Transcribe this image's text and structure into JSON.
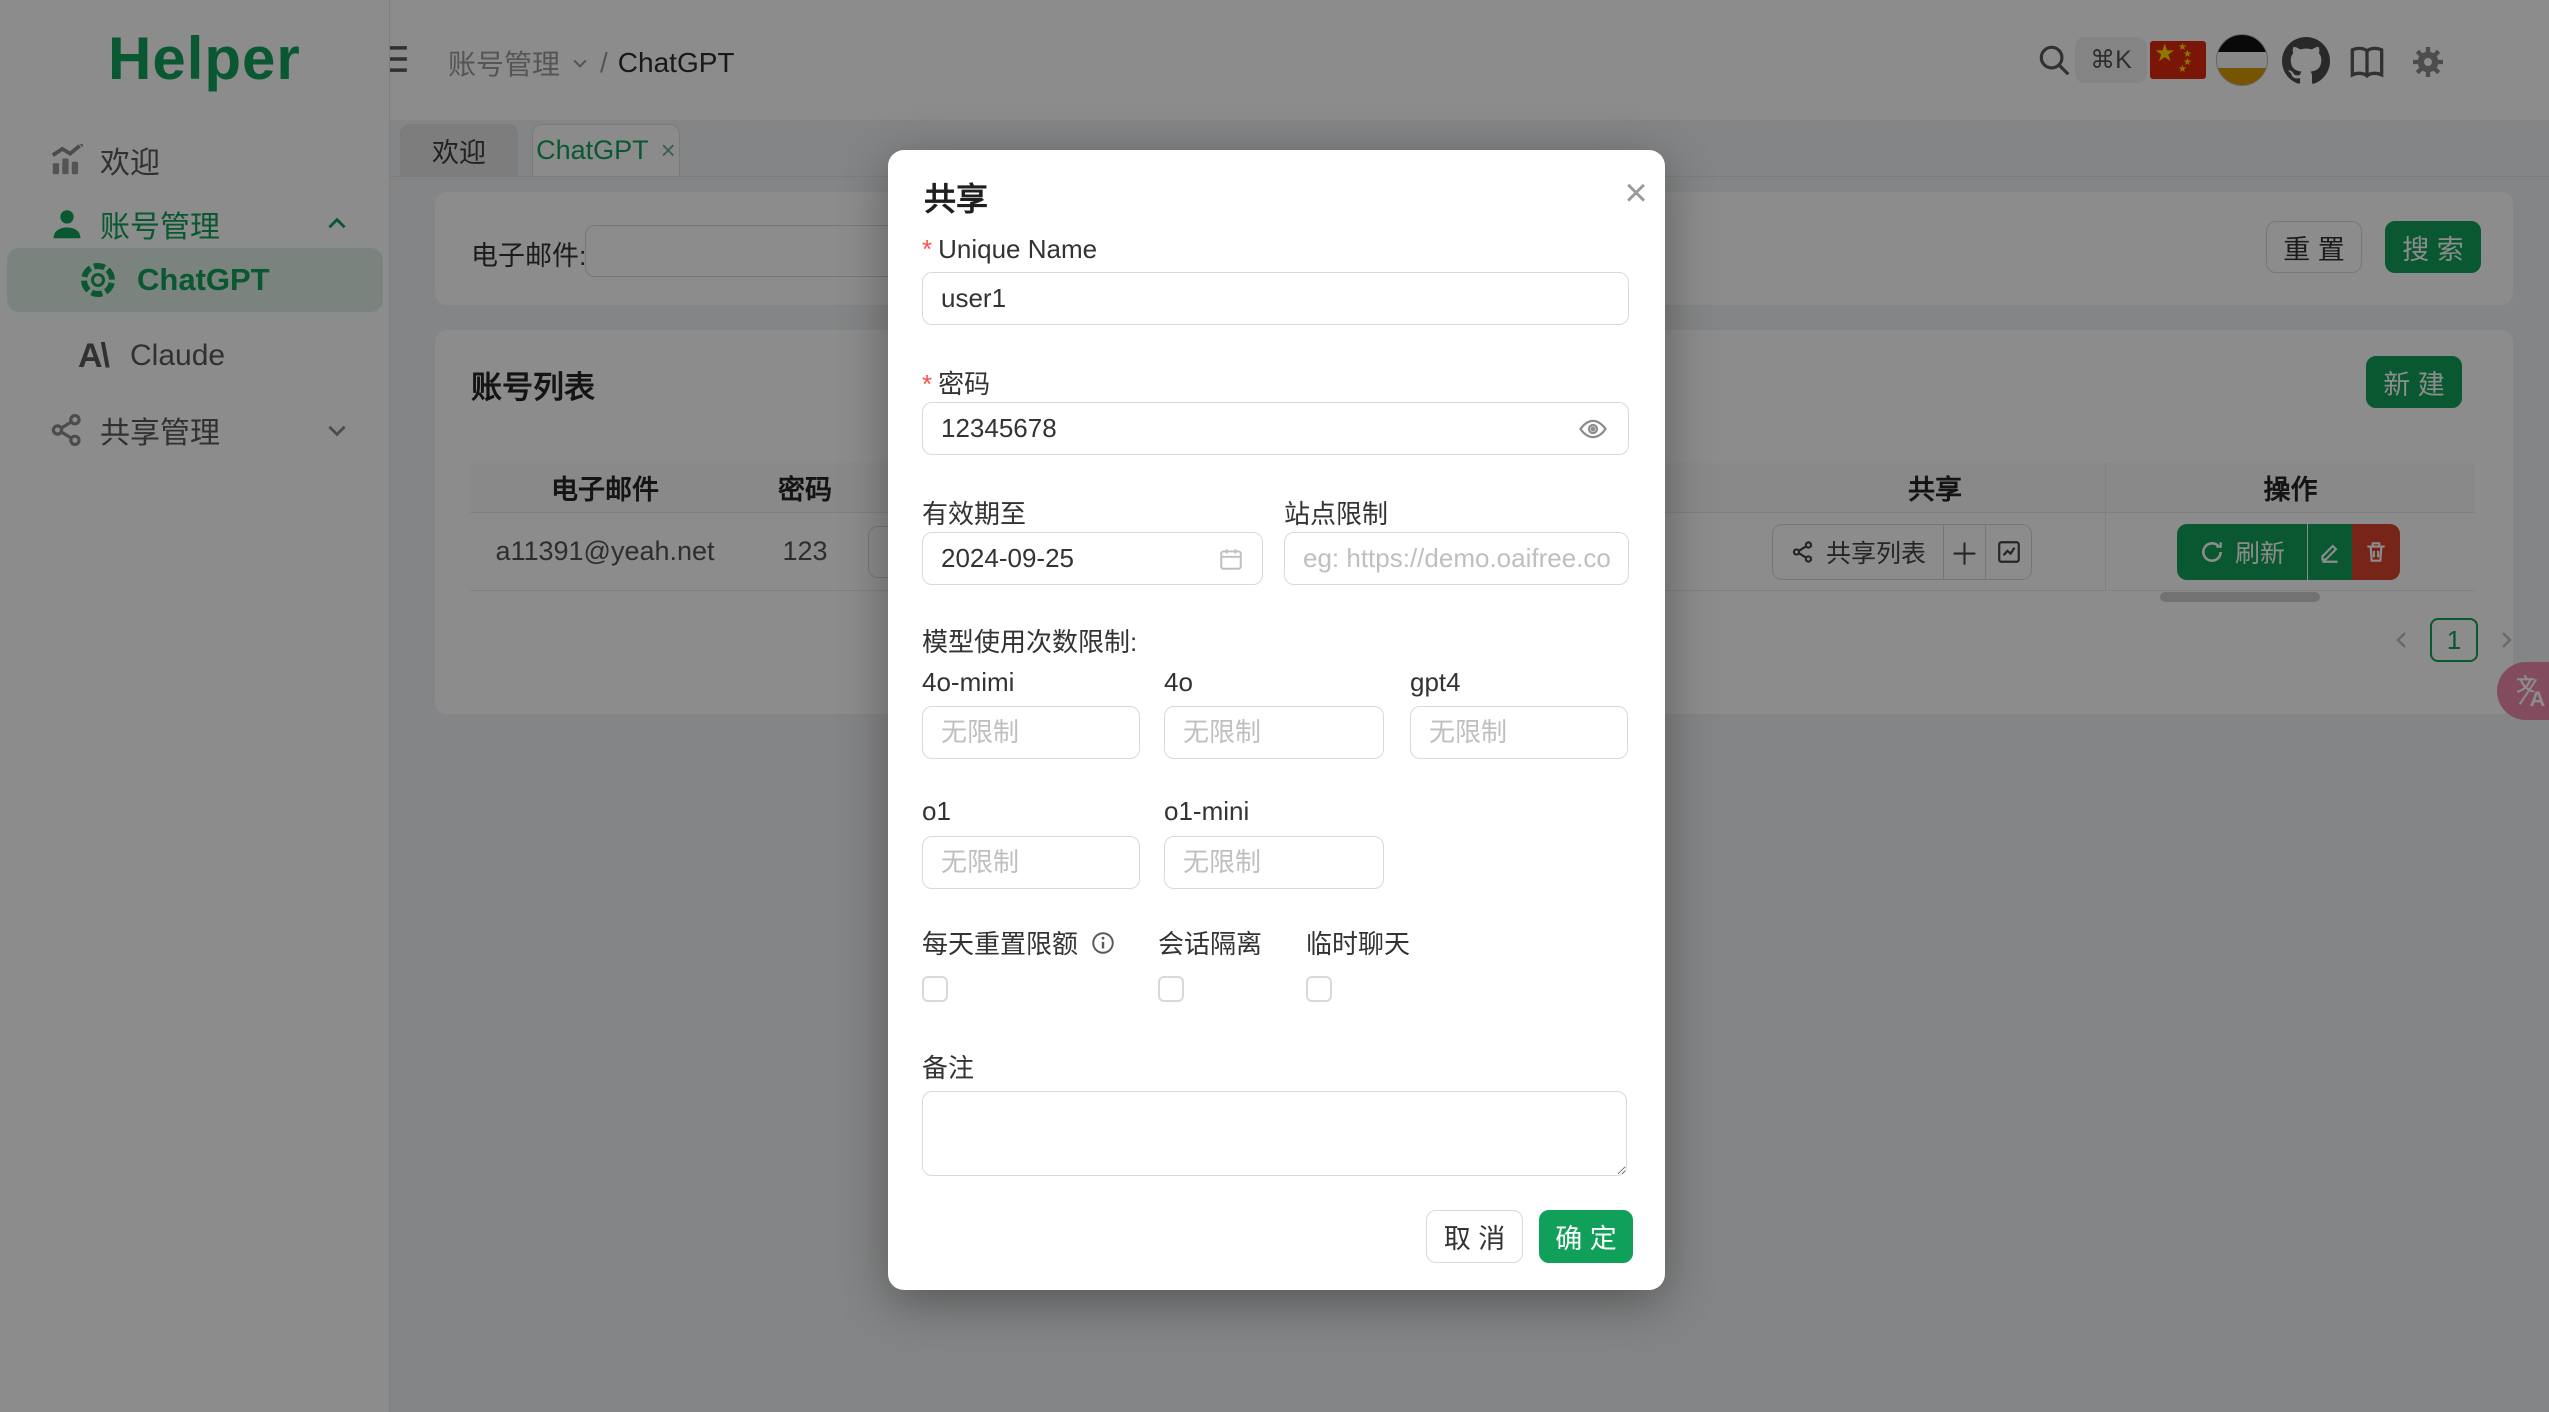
{
  "theme": {
    "accent_green": "#11a05a",
    "danger_red": "#d9432f",
    "translate_pink": "#ef8bab"
  },
  "brand": {
    "logo": "Helper"
  },
  "header": {
    "breadcrumb_section": "账号管理",
    "breadcrumb_sep": "/",
    "breadcrumb_current": "ChatGPT",
    "shortcut": "⌘K"
  },
  "sidebar": {
    "welcome": "欢迎",
    "account": "账号管理",
    "chatgpt": "ChatGPT",
    "claude": "Claude",
    "claude_mark": "A\\",
    "share": "共享管理"
  },
  "tabs": {
    "welcome": "欢迎",
    "chatgpt": "ChatGPT",
    "close": "×"
  },
  "filter": {
    "email_label": "电子邮件:",
    "reset": "重 置",
    "search": "搜 索"
  },
  "list": {
    "title": "账号列表",
    "new": "新 建",
    "col_email": "电子邮件",
    "col_password": "密码",
    "col_share": "共享",
    "col_actions": "操作",
    "row_email": "a11391@yeah.net",
    "row_password": "123",
    "share_list": "共享列表",
    "plus": "＋",
    "refresh": "刷新",
    "page": "1"
  },
  "modal": {
    "title": "共享",
    "close": "×",
    "required": "*",
    "unique_name_label": "Unique Name",
    "unique_name_value": "user1",
    "password_label": "密码",
    "password_value": "12345678",
    "valid_label": "有效期至",
    "valid_value": "2024-09-25",
    "site_label": "站点限制",
    "site_placeholder": "eg: https://demo.oaifree.com",
    "limits_label": "模型使用次数限制:",
    "models": [
      {
        "label": "4o-mimi",
        "placeholder": "无限制"
      },
      {
        "label": "4o",
        "placeholder": "无限制"
      },
      {
        "label": "gpt4",
        "placeholder": "无限制"
      },
      {
        "label": "o1",
        "placeholder": "无限制"
      },
      {
        "label": "o1-mini",
        "placeholder": "无限制"
      }
    ],
    "check1": "每天重置限额",
    "check2": "会话隔离",
    "check3": "临时聊天",
    "note_label": "备注",
    "cancel": "取 消",
    "confirm": "确 定"
  }
}
